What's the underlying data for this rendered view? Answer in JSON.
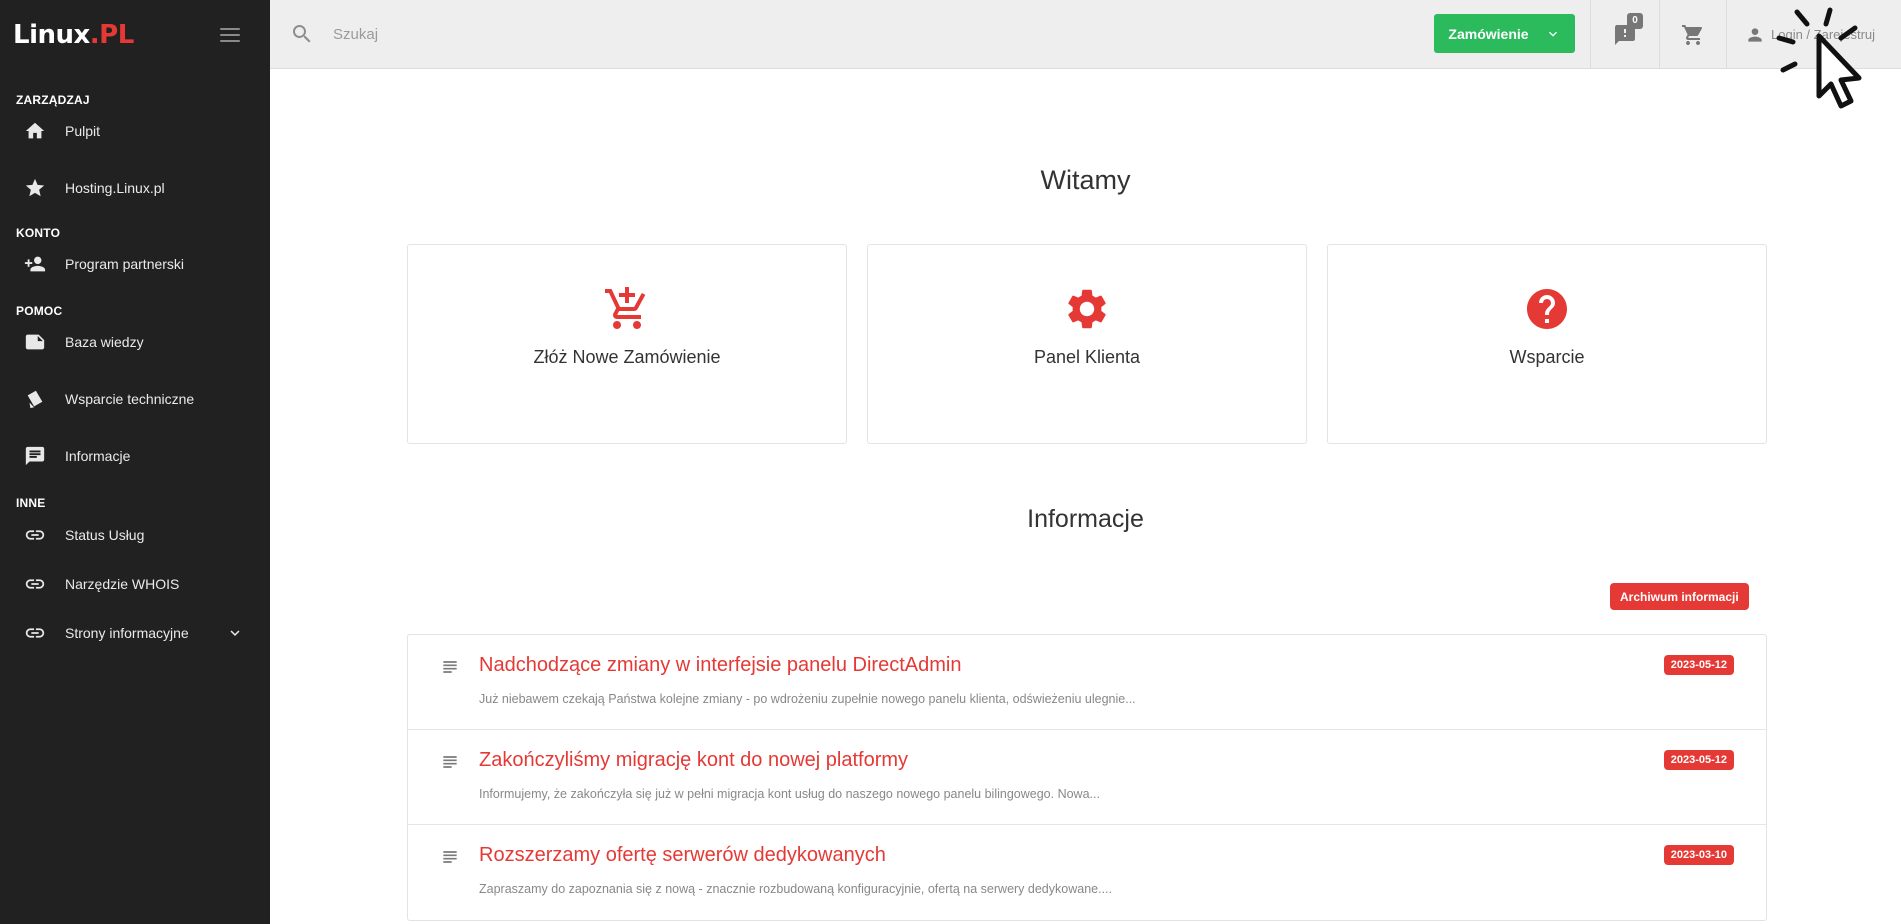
{
  "sidebar": {
    "logo": {
      "main": "Linux",
      "dot": ".",
      "accent": "PL"
    },
    "sections": {
      "manage": "ZARZĄDZAJ",
      "account": "KONTO",
      "help": "POMOC",
      "other": "INNE"
    },
    "items": {
      "dashboard": "Pulpit",
      "hosting": "Hosting.Linux.pl",
      "affiliate": "Program partnerski",
      "knowledgebase": "Baza wiedzy",
      "support": "Wsparcie techniczne",
      "announcements": "Informacje",
      "status": "Status Usług",
      "whois": "Narzędzie WHOIS",
      "info_pages": "Strony informacyjne"
    }
  },
  "topbar": {
    "search_placeholder": "Szukaj",
    "order_label": "Zamówienie",
    "notifications_count": "0",
    "login_label": "Login / Zarejestruj"
  },
  "main": {
    "welcome": "Witamy",
    "cards": {
      "order": "Złóż Nowe Zamówienie",
      "client_panel": "Panel Klienta",
      "support": "Wsparcie"
    },
    "info_heading": "Informacje",
    "archive_label": "Archiwum informacji",
    "news": [
      {
        "title": "Nadchodzące zmiany w interfejsie panelu DirectAdmin",
        "excerpt": "Już niebawem czekają Państwa kolejne zmiany - po wdrożeniu zupełnie nowego panelu klienta, odświeżeniu ulegnie...",
        "date": "2023-05-12"
      },
      {
        "title": "Zakończyliśmy migrację kont do nowej platformy",
        "excerpt": "Informujemy, że zakończyła się już w pełni migracja kont usług do naszego nowego panelu bilingowego. Nowa...",
        "date": "2023-05-12"
      },
      {
        "title": "Rozszerzamy ofertę serwerów dedykowanych",
        "excerpt": "Zapraszamy do zapoznania się z nową - znacznie rozbudowaną konfiguracyjnie, ofertą na serwery dedykowane....",
        "date": "2023-03-10"
      }
    ]
  },
  "colors": {
    "sidebar_bg": "#212121",
    "topbar_bg": "#eeeeee",
    "accent_red": "#e53935",
    "order_green": "#2bbb5c"
  },
  "icons": {
    "menu": "hamburger-icon",
    "search": "search-icon",
    "dropdown": "chevron-down-icon",
    "notifications": "feedback-icon",
    "cart": "cart-icon",
    "user": "person-icon",
    "dashboard": "home-icon",
    "hosting": "star-icon",
    "affiliate": "person-add-icon",
    "knowledgebase": "note-icon",
    "support": "ticket-icon",
    "announcements": "announcement-icon",
    "link": "link-icon",
    "card_order": "cart-plus-icon",
    "card_panel": "gear-icon",
    "card_support": "help-circle-icon",
    "news": "subject-icon"
  }
}
